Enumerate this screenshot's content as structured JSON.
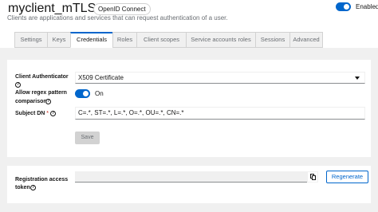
{
  "header": {
    "title": "myclient_mTLS",
    "badge": "OpenID Connect",
    "subtitle": "Clients are applications and services that can request authentication of a user.",
    "enabled_label": "Enabled"
  },
  "tabs": [
    {
      "label": "Settings"
    },
    {
      "label": "Keys"
    },
    {
      "label": "Credentials",
      "active": true
    },
    {
      "label": "Roles"
    },
    {
      "label": "Client scopes"
    },
    {
      "label": "Service accounts roles"
    },
    {
      "label": "Sessions"
    },
    {
      "label": "Advanced"
    }
  ],
  "credentials": {
    "client_authenticator_label": "Client Authenticator",
    "client_authenticator_value": "X509 Certificate",
    "regex_label_line1": "Allow regex pattern",
    "regex_label_line2": "comparison",
    "regex_state": "On",
    "subject_dn_label": "Subject DN",
    "subject_dn_required": "*",
    "subject_dn_value": "C=.*, ST=.*, L=.*, O=.*, OU=.*, CN=.*",
    "save_label": "Save"
  },
  "registration": {
    "label_line1": "Registration access",
    "label_line2": "token",
    "regenerate_label": "Regenerate"
  },
  "icons": {
    "help": "question-circle-icon",
    "copy": "copy-icon",
    "dropdown": "caret-down-icon"
  },
  "colors": {
    "primary": "#0066cc",
    "required": "#c9190b",
    "page_background": "#f0f0f0"
  }
}
